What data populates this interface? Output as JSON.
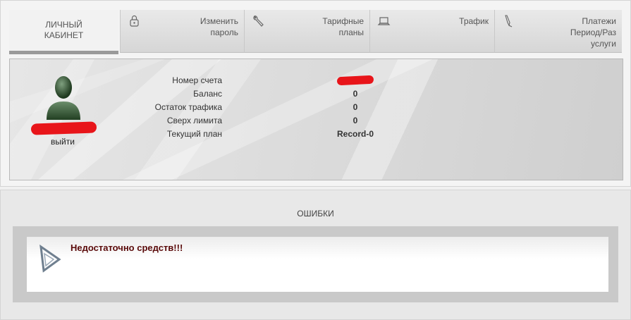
{
  "tabs": {
    "active": {
      "line1": "ЛИЧНЫЙ",
      "line2": "КАБИНЕТ"
    },
    "change_password": {
      "line1": "Изменить",
      "line2": "пароль",
      "icon": "lock-icon"
    },
    "tariff_plans": {
      "line1": "Тарифные",
      "line2": "планы",
      "icon": "wrench-icon"
    },
    "traffic": {
      "line1": "Трафик",
      "icon": "laptop-icon"
    },
    "payments": {
      "line1": "Платежи",
      "line2": "Период/Раз",
      "line3": "услуги",
      "icon": "pen-icon"
    }
  },
  "user": {
    "logout_label": "выйти",
    "avatar_icon": "user-avatar-icon"
  },
  "account": {
    "labels": [
      "Номер счета",
      "Баланс",
      "Остаток трафика",
      "Сверх лимита",
      "Текущий план"
    ],
    "balance": "0",
    "traffic_left": "0",
    "over_limit": "0",
    "plan": "Record-0"
  },
  "errors": {
    "title": "ОШИБКИ",
    "message": "Недостаточно средств!!!",
    "icon": "warning-triangle-icon"
  },
  "colors": {
    "redaction": "#e8151a",
    "error_text": "#5a0a0a"
  }
}
